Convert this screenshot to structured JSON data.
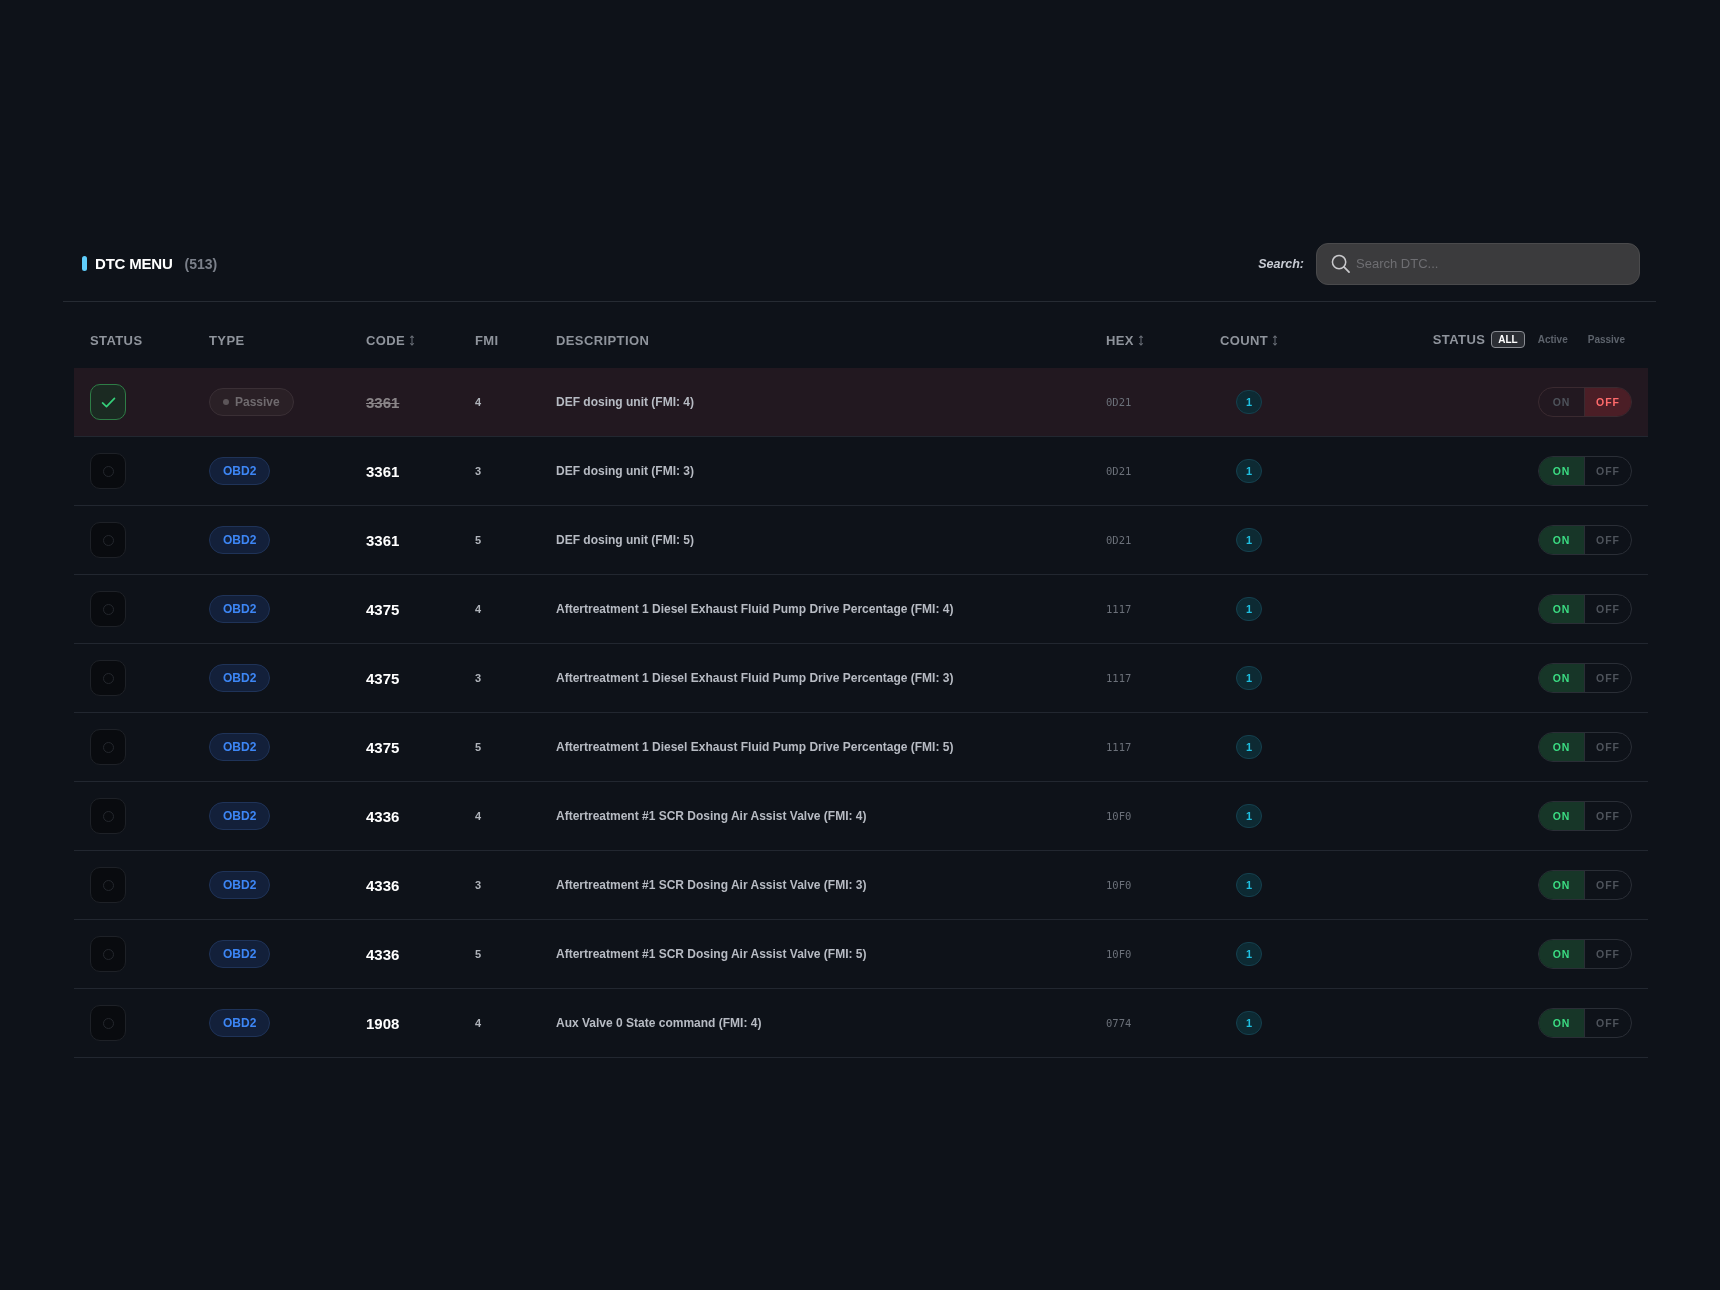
{
  "panel": {
    "title": "DTC MENU",
    "count": "(513)"
  },
  "search": {
    "label": "Search:",
    "placeholder": "Search DTC..."
  },
  "table": {
    "columns": [
      {
        "label": "STATUS",
        "sortable": false
      },
      {
        "label": "TYPE",
        "sortable": false
      },
      {
        "label": "CODE",
        "sortable": true
      },
      {
        "label": "FMI",
        "sortable": false
      },
      {
        "label": "DESCRIPTION",
        "sortable": false
      },
      {
        "label": "HEX",
        "sortable": true
      },
      {
        "label": "COUNT",
        "sortable": true
      },
      {
        "label": "STATUS",
        "sortable": false,
        "filters": [
          {
            "label": "ALL",
            "selected": true
          },
          {
            "label": "Active",
            "selected": false
          },
          {
            "label": "Passive",
            "selected": false
          }
        ]
      }
    ],
    "rows": [
      {
        "checked": true,
        "type": {
          "label": "Passive",
          "kind": "passive"
        },
        "code": "3361",
        "fmi": "4",
        "description": "DEF dosing unit (FMI: 4)",
        "hex": "0D21",
        "count": "1",
        "on": false,
        "on_label": "ON",
        "off_label": "OFF"
      },
      {
        "checked": false,
        "type": {
          "label": "OBD2",
          "kind": "obd2"
        },
        "code": "3361",
        "fmi": "3",
        "description": "DEF dosing unit (FMI: 3)",
        "hex": "0D21",
        "count": "1",
        "on": true,
        "on_label": "ON",
        "off_label": "OFF"
      },
      {
        "checked": false,
        "type": {
          "label": "OBD2",
          "kind": "obd2"
        },
        "code": "3361",
        "fmi": "5",
        "description": "DEF dosing unit (FMI: 5)",
        "hex": "0D21",
        "count": "1",
        "on": true,
        "on_label": "ON",
        "off_label": "OFF"
      },
      {
        "checked": false,
        "type": {
          "label": "OBD2",
          "kind": "obd2"
        },
        "code": "4375",
        "fmi": "4",
        "description": "Aftertreatment 1 Diesel Exhaust Fluid Pump Drive Percentage (FMI: 4)",
        "hex": "1117",
        "count": "1",
        "on": true,
        "on_label": "ON",
        "off_label": "OFF"
      },
      {
        "checked": false,
        "type": {
          "label": "OBD2",
          "kind": "obd2"
        },
        "code": "4375",
        "fmi": "3",
        "description": "Aftertreatment 1 Diesel Exhaust Fluid Pump Drive Percentage (FMI: 3)",
        "hex": "1117",
        "count": "1",
        "on": true,
        "on_label": "ON",
        "off_label": "OFF"
      },
      {
        "checked": false,
        "type": {
          "label": "OBD2",
          "kind": "obd2"
        },
        "code": "4375",
        "fmi": "5",
        "description": "Aftertreatment 1 Diesel Exhaust Fluid Pump Drive Percentage (FMI: 5)",
        "hex": "1117",
        "count": "1",
        "on": true,
        "on_label": "ON",
        "off_label": "OFF"
      },
      {
        "checked": false,
        "type": {
          "label": "OBD2",
          "kind": "obd2"
        },
        "code": "4336",
        "fmi": "4",
        "description": "Aftertreatment #1 SCR Dosing Air Assist Valve (FMI: 4)",
        "hex": "10F0",
        "count": "1",
        "on": true,
        "on_label": "ON",
        "off_label": "OFF"
      },
      {
        "checked": false,
        "type": {
          "label": "OBD2",
          "kind": "obd2"
        },
        "code": "4336",
        "fmi": "3",
        "description": "Aftertreatment #1 SCR Dosing Air Assist Valve (FMI: 3)",
        "hex": "10F0",
        "count": "1",
        "on": true,
        "on_label": "ON",
        "off_label": "OFF"
      },
      {
        "checked": false,
        "type": {
          "label": "OBD2",
          "kind": "obd2"
        },
        "code": "4336",
        "fmi": "5",
        "description": "Aftertreatment #1 SCR Dosing Air Assist Valve (FMI: 5)",
        "hex": "10F0",
        "count": "1",
        "on": true,
        "on_label": "ON",
        "off_label": "OFF"
      },
      {
        "checked": false,
        "type": {
          "label": "OBD2",
          "kind": "obd2"
        },
        "code": "1908",
        "fmi": "4",
        "description": "Aux Valve 0 State command (FMI: 4)",
        "hex": "0774",
        "count": "1",
        "on": true,
        "on_label": "ON",
        "off_label": "OFF"
      }
    ]
  }
}
